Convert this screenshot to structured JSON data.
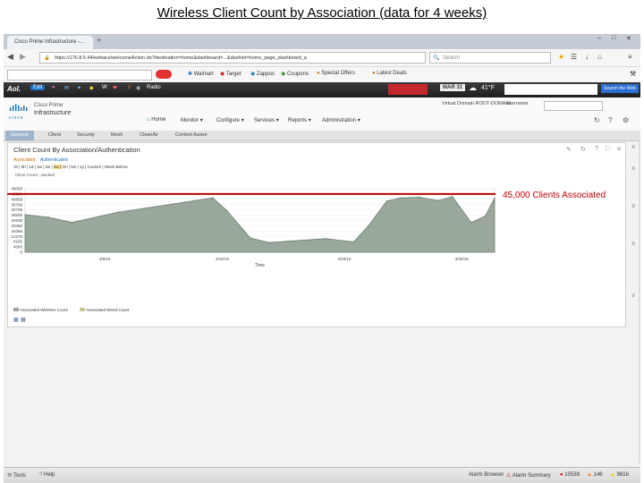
{
  "slide": {
    "title": "Wireless Client Count by Association (data for 4 weeks)"
  },
  "browser": {
    "tab_title": "Cisco Prime Infrastructure -...",
    "new_tab_label": "+",
    "url": "https://176.8.5.44/webacs/welcomeAction.do?destination=home&dashboard=...&dashlet=home_page_dashboard_a",
    "search_placeholder": "Search",
    "window_controls": [
      "–",
      "□",
      "✕"
    ]
  },
  "bookmarks": [
    {
      "label": "Walmart",
      "icon": "walmart-icon"
    },
    {
      "label": "Target",
      "icon": "target-icon"
    },
    {
      "label": "Zappos",
      "icon": "zappos-icon"
    },
    {
      "label": "Coupons",
      "icon": "coupons-icon"
    },
    {
      "label": "Special Offers",
      "icon": "special-offers-icon"
    },
    {
      "label": "Latest Deals",
      "icon": "latest-deals-icon"
    }
  ],
  "aol_toolbar": {
    "logo": "Aol.",
    "edit_label": "Edit",
    "radio_label": "Radio",
    "date": "MAR 31",
    "weather": "41°F",
    "search_web_label": "Search the Web"
  },
  "app": {
    "brand_line1": "Cisco Prime",
    "brand_line2": "Infrastructure",
    "virtual_domain": "Virtual Domain ROOT-DOMAIN",
    "user": "username",
    "nav": [
      {
        "label": "Home"
      },
      {
        "label": "Monitor"
      },
      {
        "label": "Configure"
      },
      {
        "label": "Services"
      },
      {
        "label": "Reports"
      },
      {
        "label": "Administration"
      }
    ],
    "subtabs": [
      "General",
      "Client",
      "Security",
      "Mesh",
      "CleanAir",
      "Context Aware"
    ],
    "active_subtab": "General"
  },
  "dashlet": {
    "title": "Client Count By Association/Authentication",
    "filter_associated": "Associated",
    "filter_authenticated": "Authenticated",
    "time_ranges": [
      "1h",
      "6h",
      "1d",
      "1w",
      "2w",
      "4w",
      "2m",
      "6m",
      "1y",
      "Custom",
      "Week Before"
    ],
    "active_range": "4w",
    "stacked_label": "Client Count : stacked",
    "legend": [
      {
        "label": "Associated Wireless Count",
        "color": "#9aa89c"
      },
      {
        "label": "Associated Wired Count",
        "color": "#c8c59a"
      }
    ]
  },
  "annotation": {
    "text": "45,000 Clients Associated",
    "color": "#c00000"
  },
  "chart_data": {
    "type": "area",
    "xlabel": "Time",
    "ylabel": "",
    "y_ticks": [
      "49058",
      "45068",
      "40858",
      "36768",
      "32708",
      "28608",
      "24538",
      "20468",
      "16368",
      "12278",
      "8185",
      "4093",
      "0"
    ],
    "x_ticks": [
      "3/9/15",
      "3/16/15",
      "3/23/15",
      "3/30/15"
    ],
    "reference_line": 45000,
    "series": [
      {
        "name": "Associated Wireless Count",
        "color": "#9aa89c",
        "x": [
          0,
          0.05,
          0.1,
          0.2,
          0.32,
          0.4,
          0.43,
          0.48,
          0.52,
          0.56,
          0.64,
          0.7,
          0.73,
          0.77,
          0.8,
          0.84,
          0.88,
          0.91,
          0.95,
          0.98,
          1.0
        ],
        "values": [
          29000,
          27000,
          23000,
          31000,
          37500,
          42000,
          32000,
          11000,
          7500,
          8500,
          10500,
          8000,
          20000,
          39500,
          42000,
          42500,
          40000,
          43000,
          23000,
          28000,
          42000
        ]
      }
    ]
  },
  "statusbar": {
    "tools": "Tools",
    "help": "Help",
    "alarm_browser": "Alarm Browser",
    "alarm_summary": "Alarm Summary",
    "critical": "10538",
    "major": "146",
    "minor": "9816"
  }
}
